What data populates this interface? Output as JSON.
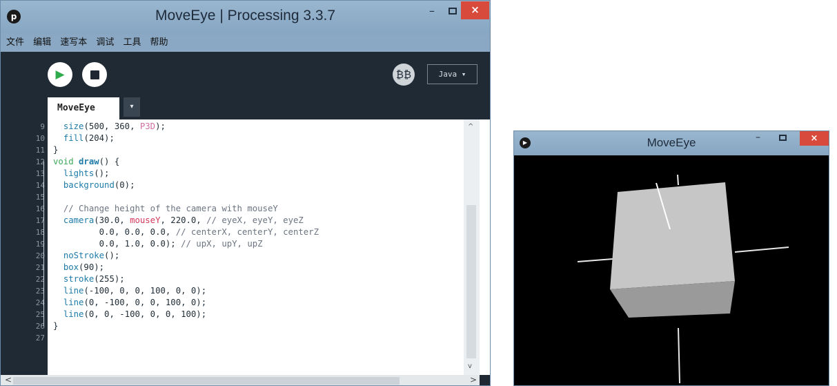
{
  "ide_window": {
    "title": "MoveEye | Processing 3.3.7",
    "app_icon": "processing-icon",
    "controls": {
      "minimize": "–",
      "close": "×"
    },
    "menu": [
      "文件",
      "编辑",
      "速写本",
      "调试",
      "工具",
      "帮助"
    ],
    "toolbar": {
      "run_icon": "▶",
      "debug_icon": "₿₿",
      "mode_label": "Java ▾"
    },
    "tabs": [
      {
        "label": "MoveEye"
      }
    ],
    "tab_menu_icon": "▾",
    "line_numbers": [
      "9",
      "10",
      "11",
      "12",
      "13",
      "14",
      "15",
      "16",
      "17",
      "18",
      "19",
      "20",
      "21",
      "22",
      "23",
      "24",
      "25",
      "26",
      "27"
    ],
    "code_lines": [
      [
        {
          "t": "  "
        },
        {
          "t": "size",
          "c": "fn"
        },
        {
          "t": "(500, 360, "
        },
        {
          "t": "P3D",
          "c": "const"
        },
        {
          "t": ");"
        }
      ],
      [
        {
          "t": "  "
        },
        {
          "t": "fill",
          "c": "fn"
        },
        {
          "t": "(204);"
        }
      ],
      [
        {
          "t": "}"
        }
      ],
      [
        {
          "t": "void",
          "c": "kw"
        },
        {
          "t": " "
        },
        {
          "t": "draw",
          "c": "fnb"
        },
        {
          "t": "() {"
        }
      ],
      [
        {
          "t": "  "
        },
        {
          "t": "lights",
          "c": "fn"
        },
        {
          "t": "();"
        }
      ],
      [
        {
          "t": "  "
        },
        {
          "t": "background",
          "c": "fn"
        },
        {
          "t": "(0);"
        }
      ],
      [
        {
          "t": ""
        }
      ],
      [
        {
          "t": "  "
        },
        {
          "t": "// Change height of the camera with mouseY",
          "c": "cm"
        }
      ],
      [
        {
          "t": "  "
        },
        {
          "t": "camera",
          "c": "fn"
        },
        {
          "t": "(30.0, "
        },
        {
          "t": "mouseY",
          "c": "var"
        },
        {
          "t": ", 220.0, "
        },
        {
          "t": "// eyeX, eyeY, eyeZ",
          "c": "cm"
        }
      ],
      [
        {
          "t": "         0.0, 0.0, 0.0, "
        },
        {
          "t": "// centerX, centerY, centerZ",
          "c": "cm"
        }
      ],
      [
        {
          "t": "         0.0, 1.0, 0.0); "
        },
        {
          "t": "// upX, upY, upZ",
          "c": "cm"
        }
      ],
      [
        {
          "t": "  "
        },
        {
          "t": "noStroke",
          "c": "fn"
        },
        {
          "t": "();"
        }
      ],
      [
        {
          "t": "  "
        },
        {
          "t": "box",
          "c": "fn"
        },
        {
          "t": "(90);"
        }
      ],
      [
        {
          "t": "  "
        },
        {
          "t": "stroke",
          "c": "fn"
        },
        {
          "t": "(255);"
        }
      ],
      [
        {
          "t": "  "
        },
        {
          "t": "line",
          "c": "fn"
        },
        {
          "t": "(-100, 0, 0, 100, 0, 0);"
        }
      ],
      [
        {
          "t": "  "
        },
        {
          "t": "line",
          "c": "fn"
        },
        {
          "t": "(0, -100, 0, 0, 100, 0);"
        }
      ],
      [
        {
          "t": "  "
        },
        {
          "t": "line",
          "c": "fn"
        },
        {
          "t": "(0, 0, -100, 0, 0, 100);"
        }
      ],
      [
        {
          "t": "}"
        }
      ],
      [
        {
          "t": ""
        }
      ]
    ],
    "scroll": {
      "up": "^",
      "down": "v",
      "left": "<",
      "right": ">"
    }
  },
  "sketch_window": {
    "title": "MoveEye",
    "controls": {
      "minimize": "–",
      "close": "×"
    },
    "scene": "rotated-cube-with-axis-lines"
  },
  "colors": {
    "editor_background": "#202a35",
    "keyword": "#3ba85a",
    "function": "#1e7ba8",
    "comment": "#6b7480",
    "variable": "#d4375a",
    "constant": "#d16fa3",
    "close_button": "#d84a3b"
  }
}
